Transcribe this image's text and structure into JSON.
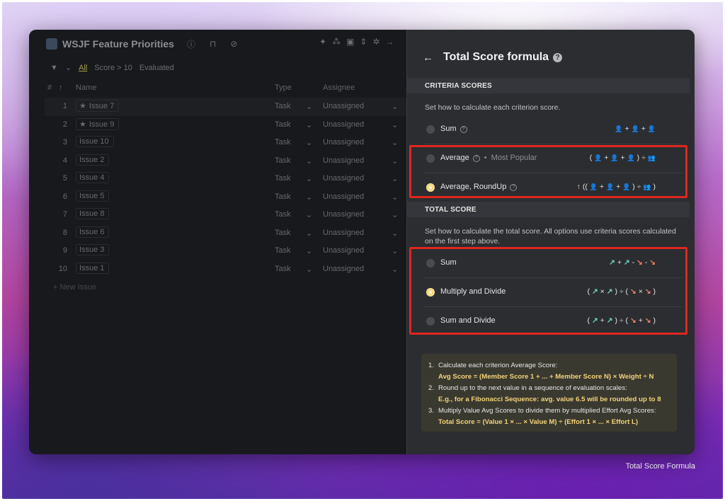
{
  "caption": "Total Score Formula",
  "app": {
    "title": "WSJF Feature Priorities",
    "filters": [
      "All",
      "Score > 10",
      "Evaluated"
    ],
    "columns": {
      "name": "Name",
      "type": "Type",
      "assignee": "Assignee"
    },
    "rows": [
      {
        "num": "1",
        "issue": "Issue 7",
        "starred": true,
        "type": "Task",
        "assignee": "Unassigned"
      },
      {
        "num": "2",
        "issue": "Issue 9",
        "starred": true,
        "type": "Task",
        "assignee": "Unassigned"
      },
      {
        "num": "3",
        "issue": "Issue 10",
        "starred": false,
        "type": "Task",
        "assignee": "Unassigned"
      },
      {
        "num": "4",
        "issue": "Issue 2",
        "starred": false,
        "type": "Task",
        "assignee": "Unassigned"
      },
      {
        "num": "5",
        "issue": "Issue 4",
        "starred": false,
        "type": "Task",
        "assignee": "Unassigned"
      },
      {
        "num": "6",
        "issue": "Issue 5",
        "starred": false,
        "type": "Task",
        "assignee": "Unassigned"
      },
      {
        "num": "7",
        "issue": "Issue 8",
        "starred": false,
        "type": "Task",
        "assignee": "Unassigned"
      },
      {
        "num": "8",
        "issue": "Issue 6",
        "starred": false,
        "type": "Task",
        "assignee": "Unassigned"
      },
      {
        "num": "9",
        "issue": "Issue 3",
        "starred": false,
        "type": "Task",
        "assignee": "Unassigned"
      },
      {
        "num": "10",
        "issue": "Issue 1",
        "starred": false,
        "type": "Task",
        "assignee": "Unassigned"
      }
    ],
    "new_issue": "+ New Issue"
  },
  "panel": {
    "title": "Total Score formula",
    "criteria": {
      "header": "CRITERIA SCORES",
      "description": "Set how to calculate each criterion score.",
      "options": [
        {
          "label": "Sum",
          "selected": false
        },
        {
          "label": "Average",
          "tag": "Most Popular",
          "selected": false
        },
        {
          "label": "Average, RoundUp",
          "selected": true
        }
      ]
    },
    "total": {
      "header": "TOTAL SCORE",
      "description": "Set how to calculate the total score. All options use criteria scores calculated on the first step above.",
      "options": [
        {
          "label": "Sum",
          "selected": false
        },
        {
          "label": "Multiply and Divide",
          "selected": true
        },
        {
          "label": "Sum and Divide",
          "selected": false
        }
      ]
    },
    "notes": [
      {
        "num": "1.",
        "text": "Calculate each criterion Average Score:",
        "formula": "Avg Score = (Member Score 1 + ... + Member Score N) × Weight ÷ N"
      },
      {
        "num": "2.",
        "text": "Round up to the next value in a sequence of evaluation scales:",
        "formula": "E.g., for a Fibonacci Sequence: avg. value 6.5 will be rounded up to 8"
      },
      {
        "num": "3.",
        "text": "Multiply Value Avg Scores to divide them by multiplied Effort Avg Scores:",
        "formula": "Total Score = (Value 1 × ... × Value M) ÷ (Effort 1 × ... × Effort L)"
      }
    ]
  },
  "colors": {
    "accent": "#f3d98a",
    "highlight": "#e0261f",
    "value_arrow": "#6fd1b6",
    "effort_arrow": "#ef7c6a"
  }
}
